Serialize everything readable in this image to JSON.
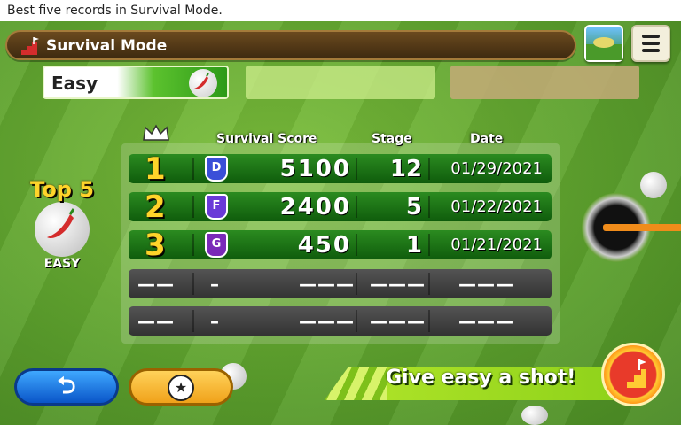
{
  "top_bar": {
    "text": "Best five records in Survival Mode."
  },
  "header": {
    "title": "Survival Mode",
    "title_icon": "stairs-flag-icon",
    "course_icon": "course-thumbnail-icon",
    "menu_icon": "hamburger-menu-icon"
  },
  "difficulty_tabs": [
    {
      "label": "Easy",
      "selected": true,
      "icon": "chili-ball-icon"
    },
    {
      "label": "",
      "selected": false
    },
    {
      "label": "",
      "selected": false
    }
  ],
  "table": {
    "headers": {
      "crown": "crown-icon",
      "score": "Survival Score",
      "stage": "Stage",
      "date": "Date"
    },
    "rows": [
      {
        "rank": "1",
        "grade": "D",
        "score": "5100",
        "stage": "12",
        "date": "01/29/2021",
        "grade_color": "#3a4fd8"
      },
      {
        "rank": "2",
        "grade": "F",
        "score": "2400",
        "stage": "5",
        "date": "01/22/2021",
        "grade_color": "#6a3ad8"
      },
      {
        "rank": "3",
        "grade": "G",
        "score": "450",
        "stage": "1",
        "date": "01/21/2021",
        "grade_color": "#7a2ab8"
      },
      {
        "rank": "——",
        "grade": "–",
        "score": "———",
        "stage": "———",
        "date": "———"
      },
      {
        "rank": "——",
        "grade": "–",
        "score": "———",
        "stage": "———",
        "date": "———"
      }
    ]
  },
  "side_badge": {
    "title": "Top 5",
    "level": "EASY",
    "icon": "chili-ball-icon"
  },
  "footer": {
    "back_icon": "back-arrow-icon",
    "ranking_icon": "star-list-icon",
    "banner_text": "Give easy a shot!",
    "shot_icon": "stairs-flag-icon"
  },
  "colors": {
    "accent_green": "#2b8b20",
    "gold": "#ffd42a",
    "button_blue": "#0a55c8",
    "button_orange": "#f0a21a"
  }
}
